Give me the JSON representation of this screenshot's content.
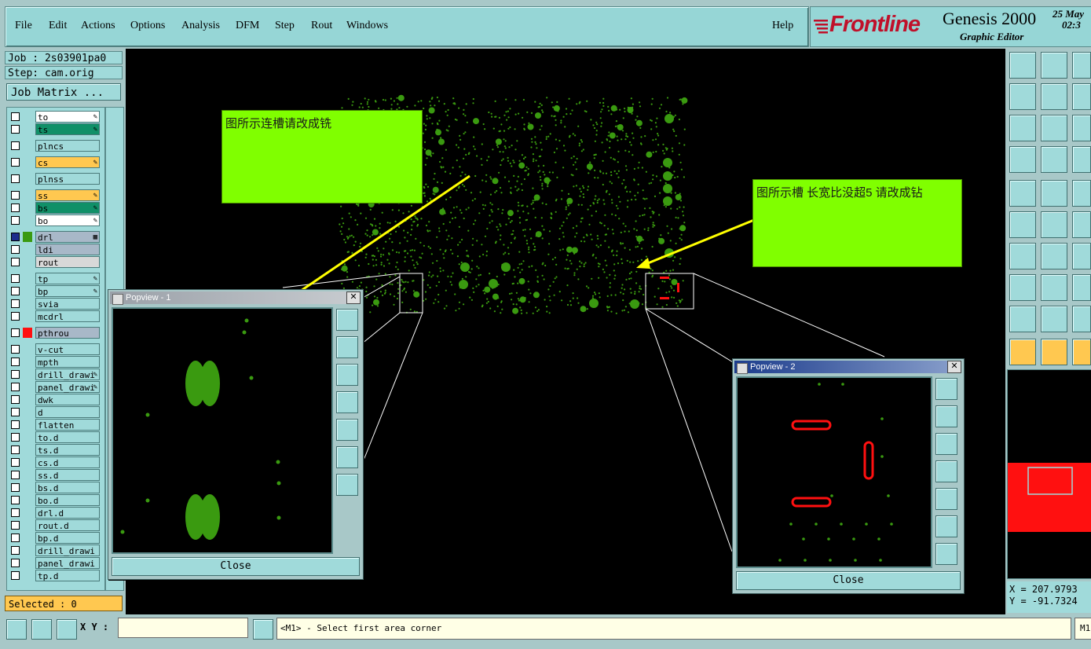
{
  "menu": {
    "items": [
      "File",
      "Edit",
      "Actions",
      "Options",
      "Analysis",
      "DFM",
      "Step",
      "Rout",
      "Windows"
    ],
    "help": "Help"
  },
  "brand": {
    "logo": "Frontline",
    "title": "Genesis 2000",
    "subtitle": "Graphic Editor",
    "date_line1": "25 May",
    "date_line2": "02:3"
  },
  "job": {
    "job_line": "Job : 2s03901pa0",
    "step_line": "Step: cam.orig",
    "matrix_button": "Job Matrix ..."
  },
  "layers": [
    {
      "name": "to",
      "bg": "#ffffff",
      "swatch": "",
      "icon": "edit-icon"
    },
    {
      "name": "ts",
      "bg": "#109068",
      "swatch": "",
      "icon": "edit-icon"
    },
    {
      "name": "plncs",
      "bg": "#a0dada",
      "swatch": "",
      "icon": ""
    },
    {
      "name": "cs",
      "bg": "#ffc850",
      "swatch": "",
      "icon": "edit-icon"
    },
    {
      "name": "plnss",
      "bg": "#a0dada",
      "swatch": "",
      "icon": ""
    },
    {
      "name": "ss",
      "bg": "#ffc850",
      "swatch": "",
      "icon": "edit-icon"
    },
    {
      "name": "bs",
      "bg": "#109068",
      "swatch": "",
      "icon": "edit-icon"
    },
    {
      "name": "bo",
      "bg": "#ffffff",
      "swatch": "",
      "icon": "edit-icon"
    },
    {
      "name": "drl",
      "bg": "#a8b8c8",
      "swatch": "#3a9a10",
      "icon": "grid-icon",
      "checked": true
    },
    {
      "name": "ldi",
      "bg": "#a8b8c8",
      "swatch": "",
      "icon": ""
    },
    {
      "name": "rout",
      "bg": "#d8d8d8",
      "swatch": "",
      "icon": ""
    },
    {
      "name": "tp",
      "bg": "#a0dada",
      "swatch": "",
      "icon": "edit-icon"
    },
    {
      "name": "bp",
      "bg": "#a0dada",
      "swatch": "",
      "icon": "edit-icon"
    },
    {
      "name": "svia",
      "bg": "#a0dada",
      "swatch": "",
      "icon": ""
    },
    {
      "name": "mcdrl",
      "bg": "#a0dada",
      "swatch": "",
      "icon": ""
    },
    {
      "name": "pthrou",
      "bg": "#a8b8c8",
      "swatch": "#ff1010",
      "icon": ""
    },
    {
      "name": "v-cut",
      "bg": "#a0dada",
      "swatch": "",
      "icon": ""
    },
    {
      "name": "mpth",
      "bg": "#a0dada",
      "swatch": "",
      "icon": ""
    },
    {
      "name": "drill_drawi",
      "bg": "#a0dada",
      "swatch": "",
      "icon": "edit-icon"
    },
    {
      "name": "panel_drawi",
      "bg": "#a0dada",
      "swatch": "",
      "icon": "edit-icon"
    },
    {
      "name": "dwk",
      "bg": "#a0dada",
      "swatch": "",
      "icon": ""
    },
    {
      "name": "d",
      "bg": "#a0dada",
      "swatch": "",
      "icon": ""
    },
    {
      "name": "flatten",
      "bg": "#a0dada",
      "swatch": "",
      "icon": ""
    },
    {
      "name": "to.d",
      "bg": "#a0dada",
      "swatch": "",
      "icon": ""
    },
    {
      "name": "ts.d",
      "bg": "#a0dada",
      "swatch": "",
      "icon": ""
    },
    {
      "name": "cs.d",
      "bg": "#a0dada",
      "swatch": "",
      "icon": ""
    },
    {
      "name": "ss.d",
      "bg": "#a0dada",
      "swatch": "",
      "icon": ""
    },
    {
      "name": "bs.d",
      "bg": "#a0dada",
      "swatch": "",
      "icon": ""
    },
    {
      "name": "bo.d",
      "bg": "#a0dada",
      "swatch": "",
      "icon": ""
    },
    {
      "name": "drl.d",
      "bg": "#a0dada",
      "swatch": "",
      "icon": ""
    },
    {
      "name": "rout.d",
      "bg": "#a0dada",
      "swatch": "",
      "icon": ""
    },
    {
      "name": "bp.d",
      "bg": "#a0dada",
      "swatch": "",
      "icon": ""
    },
    {
      "name": "drill_drawi",
      "bg": "#a0dada",
      "swatch": "",
      "icon": ""
    },
    {
      "name": "panel_drawi",
      "bg": "#a0dada",
      "swatch": "",
      "icon": ""
    },
    {
      "name": "tp.d",
      "bg": "#a0dada",
      "swatch": "",
      "icon": ""
    }
  ],
  "selected": "Selected : 0",
  "notes": {
    "left": "图所示连槽请改成铣",
    "right": "图所示槽 长宽比没超5 请改成钻"
  },
  "popview1": {
    "title": "Popview - 1",
    "close": "Close"
  },
  "popview2": {
    "title": "Popview - 2",
    "close": "Close"
  },
  "coords": {
    "x": "X = 207.9793",
    "y": "Y = -91.7324"
  },
  "status": {
    "xy_label": "X Y :",
    "xy_value": "",
    "message": "<M1> - Select first area corner",
    "mouse_button": "M1"
  },
  "colors": {
    "board_dots": "#3a9a10",
    "slots_red": "#ff1010",
    "annotation_green": "#80ff00",
    "arrow_yellow": "#ffff00"
  }
}
